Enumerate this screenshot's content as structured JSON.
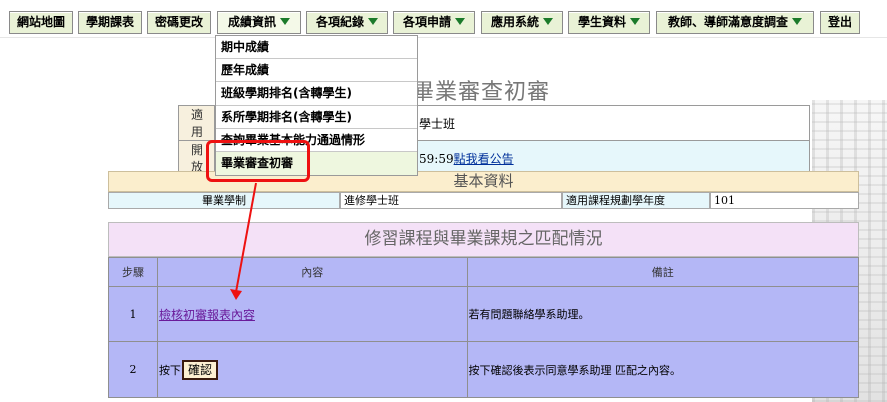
{
  "nav": {
    "items": [
      {
        "label": "網站地圖",
        "dropdown": false
      },
      {
        "label": "學期課表",
        "dropdown": false
      },
      {
        "label": "密碼更改",
        "dropdown": false
      },
      {
        "label": "成績資訊",
        "dropdown": true
      },
      {
        "label": "各項紀錄",
        "dropdown": true
      },
      {
        "label": "各項申請",
        "dropdown": true
      },
      {
        "label": "應用系統",
        "dropdown": true
      },
      {
        "label": "學生資料",
        "dropdown": true
      },
      {
        "label": "教師、導師滿意度調查",
        "dropdown": true
      },
      {
        "label": "登出",
        "dropdown": false
      }
    ]
  },
  "dropdown": {
    "items": [
      "期中成績",
      "歷年成績",
      "班級學期排名(含轉學生)",
      "系所學期排名(含轉學生)",
      "查詢畢業基本能力通過情形",
      "畢業審查初審"
    ]
  },
  "page": {
    "title": "畢業審查初審"
  },
  "info": {
    "row1_label": "適用",
    "row1_value": "學士班",
    "row2_label": "開放",
    "row2_time": "59:59",
    "row2_link": "點我看公告"
  },
  "basic": {
    "header": "基本資料",
    "program_label": "畢業學制",
    "program_value": "進修學士班",
    "year_label": "適用課程規劃學年度",
    "year_value": "101"
  },
  "match": {
    "header": "修習課程與畢業課規之匹配情況",
    "columns": {
      "step": "步驟",
      "content": "內容",
      "note": "備註"
    },
    "rows": [
      {
        "step": "1",
        "content_link": "檢核初審報表內容",
        "note": "若有問題聯絡學系助理。"
      },
      {
        "step": "2",
        "content_prefix": "按下",
        "button": "確認",
        "note": "按下確認後表示同意學系助理 匹配之內容。"
      }
    ]
  },
  "colors": {
    "nav_button_bg": "#e9f2d6",
    "nav_arrow": "#1b7a2a",
    "annotation_red": "#ee1111",
    "match_table_bg": "#b4b7f6"
  }
}
